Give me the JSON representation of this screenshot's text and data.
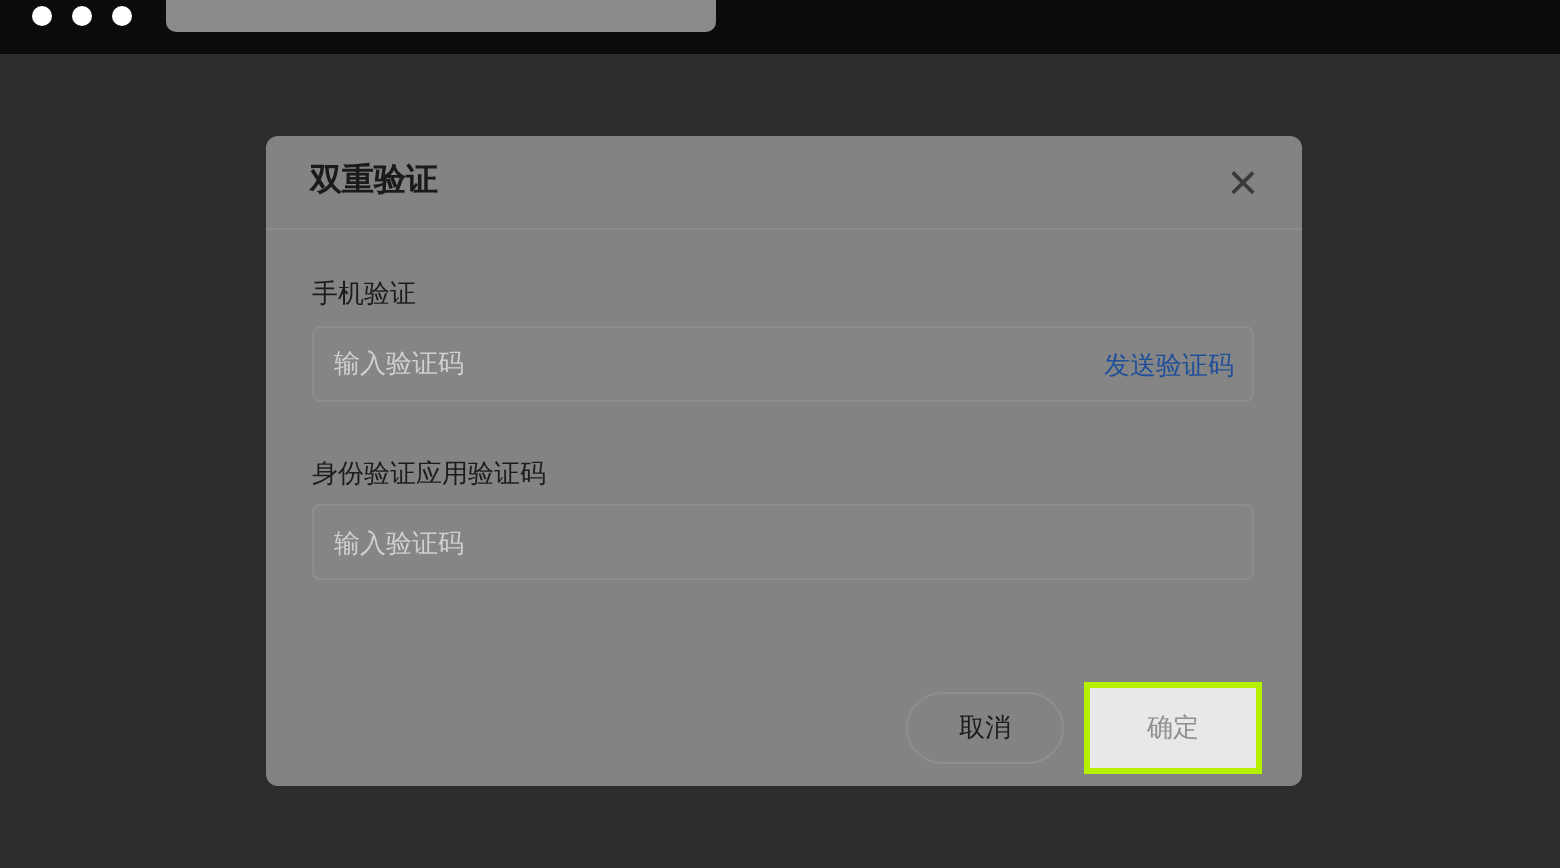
{
  "dialog": {
    "title": "双重验证",
    "close": "×",
    "fields": [
      {
        "label": "手机验证",
        "placeholder": "输入验证码",
        "action": "发送验证码"
      },
      {
        "label": "身份验证应用验证码",
        "placeholder": "输入验证码"
      }
    ],
    "buttons": [
      {
        "label": "取消",
        "kind": "secondary",
        "disabled": false,
        "highlighted": false
      },
      {
        "label": "确定",
        "kind": "primary",
        "disabled": true,
        "highlighted": true
      }
    ]
  }
}
